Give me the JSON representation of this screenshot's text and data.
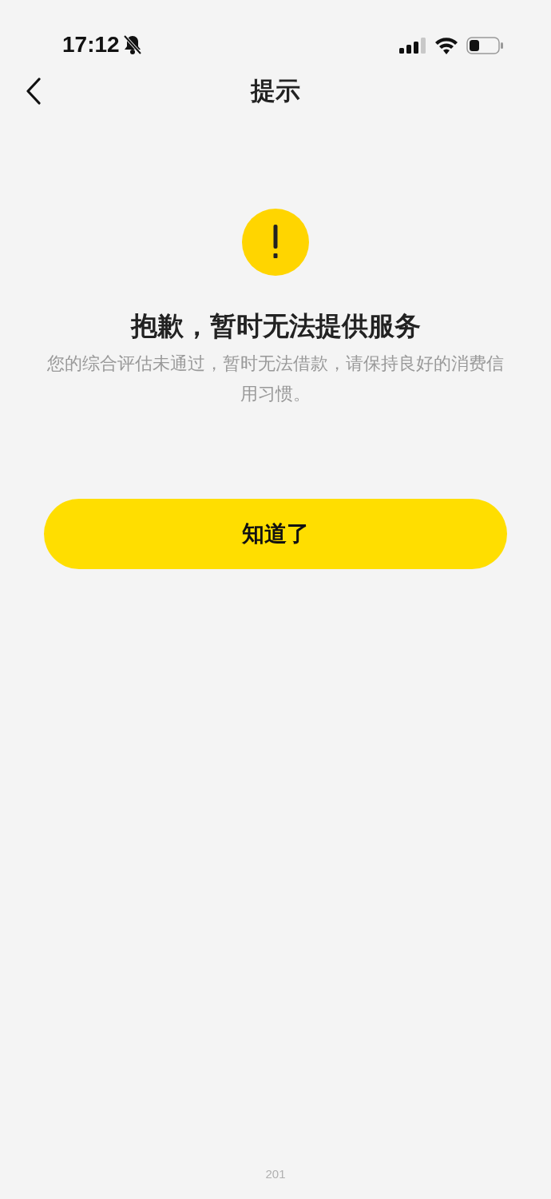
{
  "status_bar": {
    "time": "17:12"
  },
  "nav": {
    "title": "提示"
  },
  "notice": {
    "title": "抱歉，暂时无法提供服务",
    "message": "您的综合评估未通过，暂时无法借款，请保持良好的消费信用习惯。"
  },
  "button": {
    "label": "知道了"
  },
  "footer": {
    "text": "201"
  }
}
